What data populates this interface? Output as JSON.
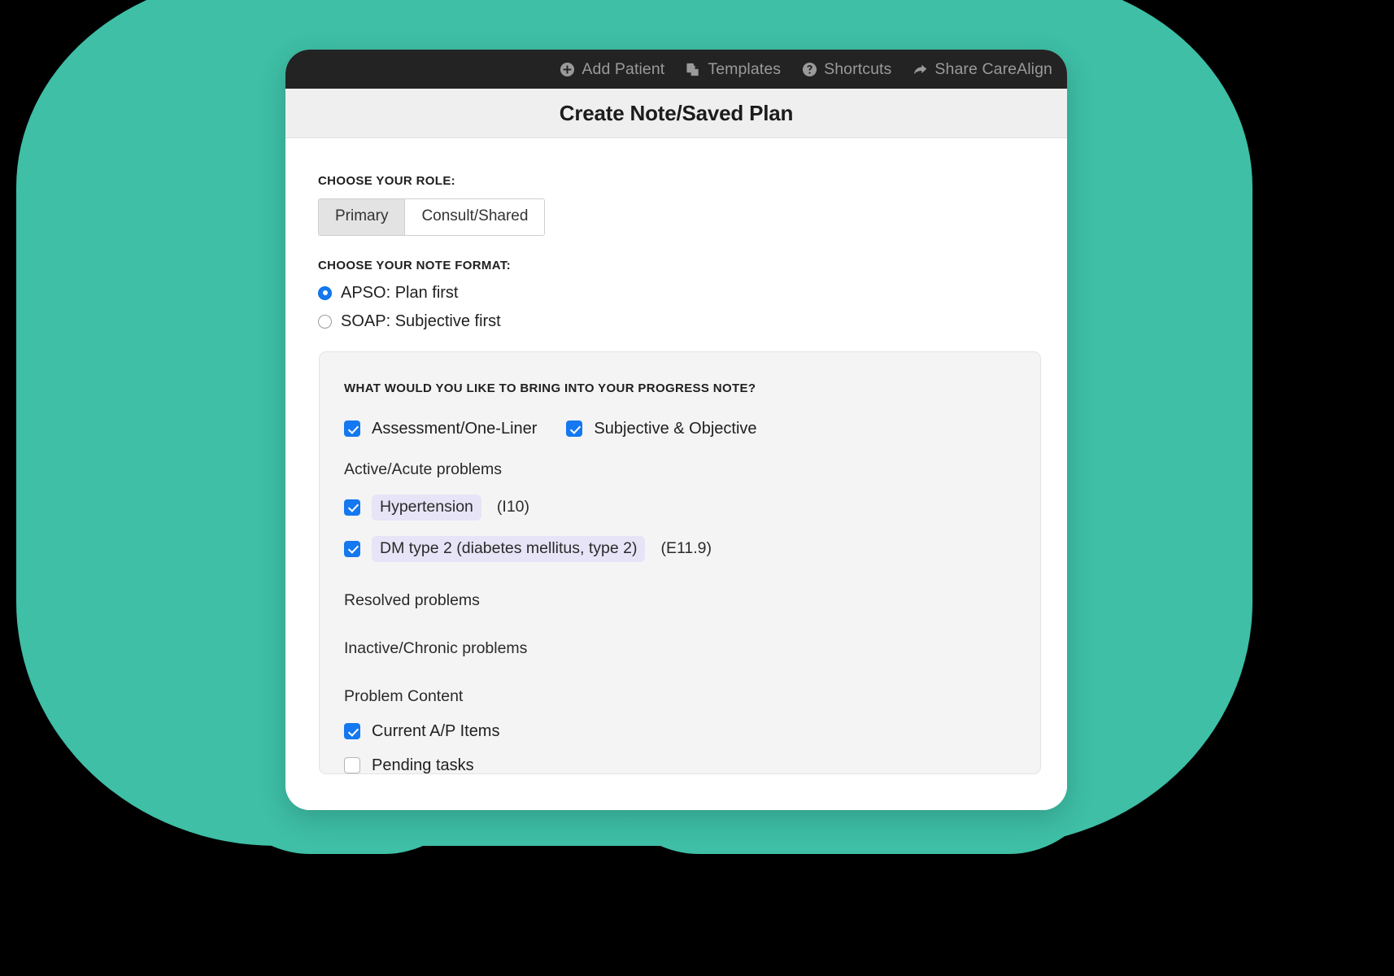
{
  "theme": {
    "page_background": "#000000",
    "blob_color": "#3ebfa6",
    "accent_blue": "#1478f0",
    "pill_color": "#e8e4f7",
    "nav_background": "#232323",
    "titlebar_background": "#efefef",
    "panel_background": "#f4f4f4"
  },
  "topnav": {
    "items": [
      {
        "label": "Add Patient",
        "icon": "plus-circle-icon"
      },
      {
        "label": "Templates",
        "icon": "copy-pages-icon"
      },
      {
        "label": "Shortcuts",
        "icon": "question-circle-icon"
      },
      {
        "label": "Share CareAlign",
        "icon": "share-arrow-icon"
      }
    ]
  },
  "titlebar": {
    "title": "Create Note/Saved Plan"
  },
  "role": {
    "label": "CHOOSE YOUR ROLE:",
    "options": [
      {
        "label": "Primary",
        "selected": true
      },
      {
        "label": "Consult/Shared",
        "selected": false
      }
    ]
  },
  "note_format": {
    "label": "CHOOSE YOUR NOTE FORMAT:",
    "options": [
      {
        "label": "APSO: Plan first",
        "selected": true
      },
      {
        "label": "SOAP: Subjective first",
        "selected": false
      }
    ]
  },
  "panel": {
    "title": "WHAT WOULD YOU LIKE TO BRING INTO YOUR PROGRESS NOTE?",
    "top_checkboxes": [
      {
        "label": "Assessment/One-Liner",
        "checked": true
      },
      {
        "label": "Subjective & Objective",
        "checked": true
      }
    ],
    "sections": [
      {
        "heading": "Active/Acute problems",
        "problems": [
          {
            "name": "Hypertension",
            "code": "(I10)",
            "checked": true
          },
          {
            "name": "DM type 2 (diabetes mellitus, type 2)",
            "code": "(E11.9)",
            "checked": true
          }
        ]
      },
      {
        "heading": "Resolved problems",
        "problems": []
      },
      {
        "heading": "Inactive/Chronic problems",
        "problems": []
      }
    ],
    "problem_content": {
      "heading": "Problem Content",
      "items": [
        {
          "label": "Current A/P Items",
          "checked": true
        },
        {
          "label": "Pending tasks",
          "checked": false
        }
      ]
    }
  }
}
